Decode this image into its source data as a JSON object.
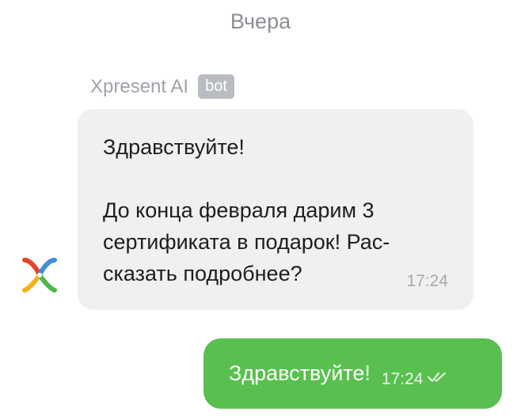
{
  "chat": {
    "date_separator": "Вчера",
    "incoming": {
      "sender_name": "Xpresent AI",
      "badge": "bot",
      "avatar_icon": "xpresent-logo-icon",
      "text": "Здравствуйте!\n\nДо конца февраля дарим 3\nсертификата в подарок! Рас-\nсказать подробнее?",
      "time": "17:24"
    },
    "outgoing": {
      "text": "Здравствуйте!",
      "time": "17:24",
      "status_icon": "double-check-icon"
    }
  },
  "colors": {
    "incoming_bubble": "#f0f0f0",
    "outgoing_bubble": "#59c04f",
    "badge": "#b9bcc0"
  }
}
